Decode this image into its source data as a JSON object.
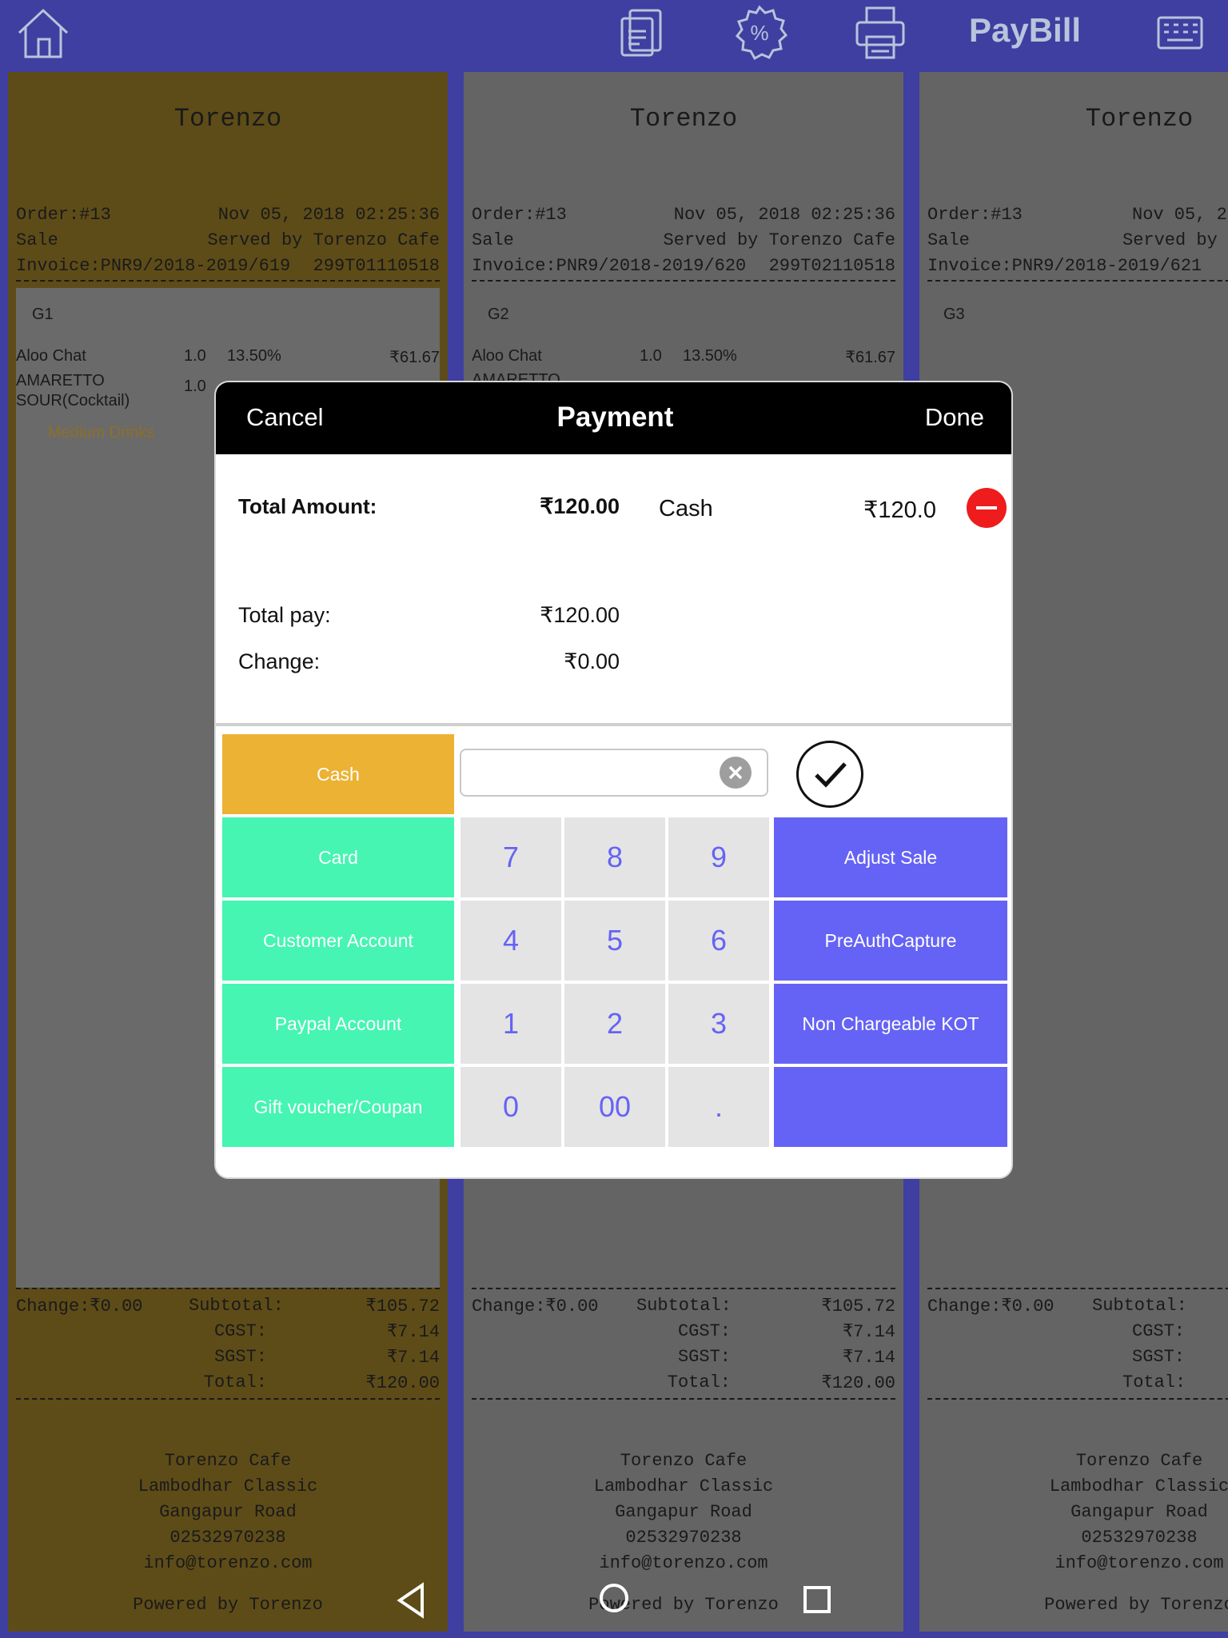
{
  "header": {
    "home_icon": "home-icon",
    "bill_icon": "receipt-icon",
    "discount_icon": "discount-percent-icon",
    "print_icon": "printer-icon",
    "title": "PayBill",
    "keyboard_icon": "keyboard-icon"
  },
  "receipts": [
    {
      "brand": "Torenzo",
      "order": "Order:#13",
      "datetime": "Nov 05, 2018 02:25:36",
      "type": "Sale",
      "served": "Served by Torenzo Cafe",
      "invoice": "Invoice:PNR9/2018-2019/619",
      "code": "299T01110518",
      "group": "G1",
      "items": [
        {
          "name": "Aloo Chat",
          "qty": "1.0",
          "tax": "13.50%",
          "amount": "₹61.67"
        },
        {
          "name": "AMARETTO SOUR(Cocktail)",
          "qty": "1.0",
          "tax": "",
          "amount": ""
        }
      ],
      "category": "Medium Drinks",
      "change": "Change:₹0.00",
      "subtotal_label": "Subtotal:",
      "subtotal": "₹105.72",
      "cgst_label": "CGST:",
      "cgst": "₹7.14",
      "sgst_label": "SGST:",
      "sgst": "₹7.14",
      "total_label": "Total:",
      "total": "₹120.00",
      "footer": [
        "Torenzo Cafe",
        "Lambodhar Classic",
        "Gangapur Road",
        "02532970238",
        "info@torenzo.com"
      ],
      "powered": "Powered by Torenzo"
    },
    {
      "brand": "Torenzo",
      "order": "Order:#13",
      "datetime": "Nov 05, 2018 02:25:36",
      "type": "Sale",
      "served": "Served by Torenzo Cafe",
      "invoice": "Invoice:PNR9/2018-2019/620",
      "code": "299T02110518",
      "group": "G2",
      "items": [
        {
          "name": "Aloo Chat",
          "qty": "1.0",
          "tax": "13.50%",
          "amount": "₹61.67"
        },
        {
          "name": "AMARETTO",
          "qty": "",
          "tax": "",
          "amount": ""
        }
      ],
      "change": "Change:₹0.00",
      "subtotal_label": "Subtotal:",
      "subtotal": "₹105.72",
      "cgst_label": "CGST:",
      "cgst": "₹7.14",
      "sgst_label": "SGST:",
      "sgst": "₹7.14",
      "total_label": "Total:",
      "total": "₹120.00",
      "footer": [
        "Torenzo Cafe",
        "Lambodhar Classic",
        "Gangapur Road",
        "02532970238",
        "info@torenzo.com"
      ],
      "powered": "Powered by Torenzo"
    },
    {
      "brand": "Torenzo",
      "order": "Order:#13",
      "datetime": "Nov 05, 2",
      "type": "Sale",
      "served": "Served by T",
      "invoice": "Invoice:PNR9/2018-2019/621",
      "group": "G3",
      "change": "Change:₹0.00",
      "subtotal_label": "Subtotal:",
      "cgst_label": "CGST:",
      "sgst_label": "SGST:",
      "total_label": "Total:",
      "footer": [
        "Torenzo Cafe",
        "Lambodhar Classic",
        "Gangapur Road",
        "02532970238",
        "info@torenzo.com"
      ],
      "powered": "Powered by Torenzo"
    }
  ],
  "payment": {
    "cancel": "Cancel",
    "title": "Payment",
    "done": "Done",
    "total_amount_label": "Total Amount:",
    "total_amount": "₹120.00",
    "method": "Cash",
    "method_amount": "₹120.0",
    "total_pay_label": "Total pay:",
    "total_pay": "₹120.00",
    "change_label": "Change:",
    "change": "₹0.00",
    "amount_input": "",
    "methods": [
      "Cash",
      "Card",
      "Customer Account",
      "Paypal Account",
      "Gift voucher/Coupan"
    ],
    "selected_method": "Cash",
    "keys": [
      "7",
      "8",
      "9",
      "4",
      "5",
      "6",
      "1",
      "2",
      "3",
      "0",
      "00",
      "."
    ],
    "actions": [
      "Adjust Sale",
      "PreAuthCapture",
      "Non Chargeable KOT",
      ""
    ],
    "colors": {
      "selected": "#ecb234",
      "method": "#45f5b1",
      "action": "#6563f5",
      "remove": "#ee1c1c"
    }
  },
  "navbar": {
    "back": "back-icon",
    "home": "home-circle-icon",
    "recents": "recents-icon"
  }
}
